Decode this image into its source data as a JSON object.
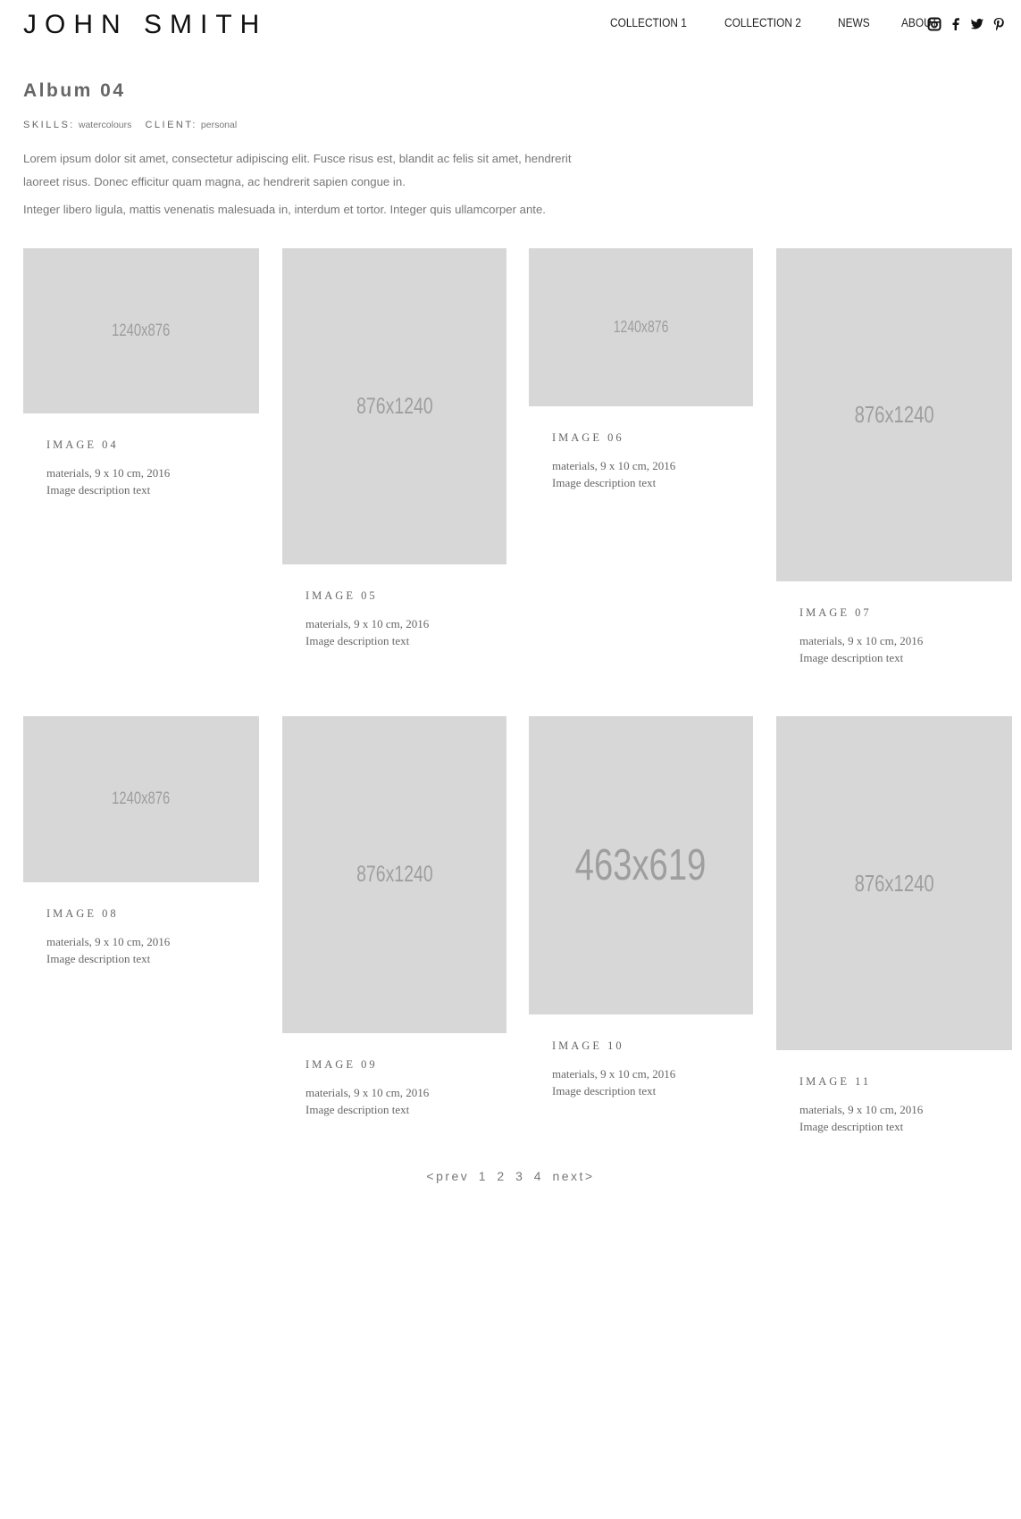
{
  "site": {
    "brand": "JOHN SMITH"
  },
  "nav": {
    "items": [
      "COLLECTION 1",
      "COLLECTION 2",
      "NEWS",
      "ABOUT"
    ]
  },
  "social": [
    "instagram-icon",
    "facebook-icon",
    "twitter-icon",
    "pinterest-icon"
  ],
  "album": {
    "title": "Album 04",
    "skills_label": "SKILLS:",
    "skills_value": "watercolours",
    "client_label": "CLIENT:",
    "client_value": "personal",
    "intro": [
      "Lorem ipsum dolor sit amet, consectetur adipiscing elit. Fusce risus est, blandit ac felis sit amet, hendrerit laoreet risus. Donec efficitur quam magna, ac hendrerit sapien congue in.",
      "Integer libero ligula, mattis venenatis malesuada in, interdum et tortor. Integer quis ullamcorper ante."
    ]
  },
  "gallery": [
    {
      "placeholder": "1240x876",
      "title": "IMAGE 04",
      "materials": "materials, 9 x 10 cm, 2016",
      "description": "Image description text"
    },
    {
      "placeholder": "876x1240",
      "title": "IMAGE 05",
      "materials": "materials, 9 x 10 cm, 2016",
      "description": "Image description text"
    },
    {
      "placeholder": "1240x876",
      "title": "IMAGE 06",
      "materials": "materials, 9 x 10 cm, 2016",
      "description": "Image description text"
    },
    {
      "placeholder": "876x1240",
      "title": "IMAGE 07",
      "materials": "materials, 9 x 10 cm, 2016",
      "description": "Image description text"
    },
    {
      "placeholder": "1240x876",
      "title": "IMAGE 08",
      "materials": "materials, 9 x 10 cm, 2016",
      "description": "Image description text"
    },
    {
      "placeholder": "876x1240",
      "title": "IMAGE 09",
      "materials": "materials, 9 x 10 cm, 2016",
      "description": "Image description text"
    },
    {
      "placeholder": "463x619",
      "title": "IMAGE 10",
      "materials": "materials, 9 x 10 cm, 2016",
      "description": "Image description text"
    },
    {
      "placeholder": "876x1240",
      "title": "IMAGE 11",
      "materials": "materials, 9 x 10 cm, 2016",
      "description": "Image description text"
    }
  ],
  "pagination": {
    "prev": "<prev",
    "pages": [
      "1",
      "2",
      "3",
      "4"
    ],
    "next": "next>"
  }
}
